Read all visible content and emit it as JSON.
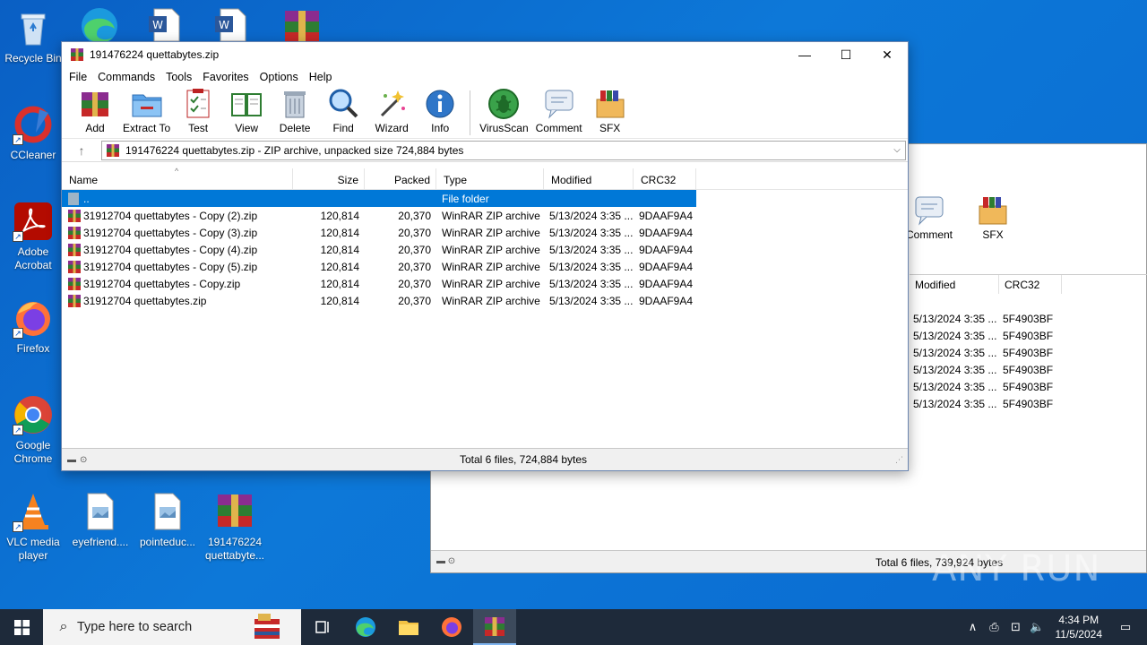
{
  "desktop": {
    "icons": [
      {
        "label": "Recycle Bin",
        "icon": "recycle-bin-icon"
      },
      {
        "label": "CCleaner",
        "icon": "ccleaner-icon"
      },
      {
        "label": "Adobe Acrobat",
        "icon": "acrobat-icon"
      },
      {
        "label": "Firefox",
        "icon": "firefox-icon"
      },
      {
        "label": "Google Chrome",
        "icon": "chrome-icon"
      },
      {
        "label": "VLC media player",
        "icon": "vlc-icon"
      },
      {
        "label": "eyefriend....",
        "icon": "image-file-icon"
      },
      {
        "label": "pointeduc...",
        "icon": "image-file-icon"
      },
      {
        "label": "191476224 quettabyte...",
        "icon": "winrar-icon"
      }
    ]
  },
  "bg_window": {
    "toolbar": [
      {
        "label": "Comment"
      },
      {
        "label": "SFX"
      }
    ],
    "headers": [
      "Modified",
      "CRC32"
    ],
    "rows": [
      {
        "modified": "5/13/2024 3:35 ...",
        "crc": "5F4903BF"
      },
      {
        "modified": "5/13/2024 3:35 ...",
        "crc": "5F4903BF"
      },
      {
        "modified": "5/13/2024 3:35 ...",
        "crc": "5F4903BF"
      },
      {
        "modified": "5/13/2024 3:35 ...",
        "crc": "5F4903BF"
      },
      {
        "modified": "5/13/2024 3:35 ...",
        "crc": "5F4903BF"
      },
      {
        "modified": "5/13/2024 3:35 ...",
        "crc": "5F4903BF"
      }
    ],
    "status": "Total 6 files, 739,924 bytes"
  },
  "window": {
    "title": "191476224 quettabytes.zip",
    "minimize": "—",
    "maximize": "☐",
    "close": "✕",
    "menu": [
      "File",
      "Commands",
      "Tools",
      "Favorites",
      "Options",
      "Help"
    ],
    "toolbar": [
      "Add",
      "Extract To",
      "Test",
      "View",
      "Delete",
      "Find",
      "Wizard",
      "Info",
      "VirusScan",
      "Comment",
      "SFX"
    ],
    "address": "191476224 quettabytes.zip - ZIP archive, unpacked size 724,884 bytes",
    "columns": [
      "Name",
      "Size",
      "Packed",
      "Type",
      "Modified",
      "CRC32"
    ],
    "parent_row": {
      "name": "..",
      "type": "File folder"
    },
    "files": [
      {
        "name": "31912704 quettabytes - Copy (2).zip",
        "size": "120,814",
        "packed": "20,370",
        "type": "WinRAR ZIP archive",
        "modified": "5/13/2024 3:35 ...",
        "crc": "9DAAF9A4"
      },
      {
        "name": "31912704 quettabytes - Copy (3).zip",
        "size": "120,814",
        "packed": "20,370",
        "type": "WinRAR ZIP archive",
        "modified": "5/13/2024 3:35 ...",
        "crc": "9DAAF9A4"
      },
      {
        "name": "31912704 quettabytes - Copy (4).zip",
        "size": "120,814",
        "packed": "20,370",
        "type": "WinRAR ZIP archive",
        "modified": "5/13/2024 3:35 ...",
        "crc": "9DAAF9A4"
      },
      {
        "name": "31912704 quettabytes - Copy (5).zip",
        "size": "120,814",
        "packed": "20,370",
        "type": "WinRAR ZIP archive",
        "modified": "5/13/2024 3:35 ...",
        "crc": "9DAAF9A4"
      },
      {
        "name": "31912704 quettabytes - Copy.zip",
        "size": "120,814",
        "packed": "20,370",
        "type": "WinRAR ZIP archive",
        "modified": "5/13/2024 3:35 ...",
        "crc": "9DAAF9A4"
      },
      {
        "name": "31912704 quettabytes.zip",
        "size": "120,814",
        "packed": "20,370",
        "type": "WinRAR ZIP archive",
        "modified": "5/13/2024 3:35 ...",
        "crc": "9DAAF9A4"
      }
    ],
    "status": "Total 6 files, 724,884 bytes"
  },
  "taskbar": {
    "search_placeholder": "Type here to search",
    "time": "4:34 PM",
    "date": "11/5/2024"
  },
  "watermark": "ANY RUN",
  "colors": {
    "selection": "#0078d7",
    "desktop": "#0d78d8",
    "taskbar": "#1e2a3a"
  }
}
